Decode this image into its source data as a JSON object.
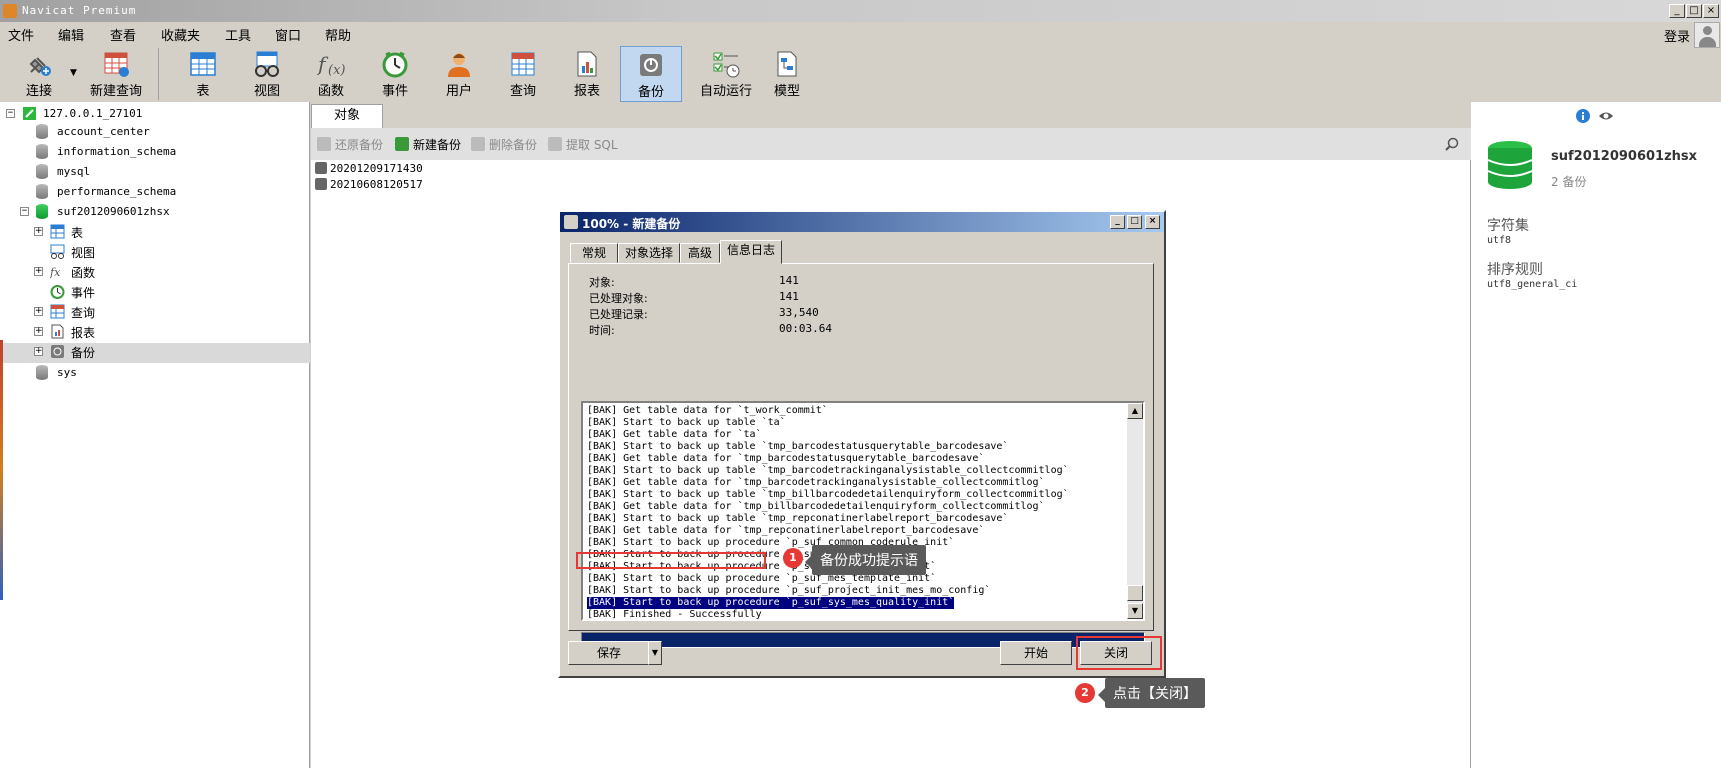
{
  "window": {
    "title": "Navicat Premium",
    "min": "_",
    "max": "□",
    "close": "×"
  },
  "menu": [
    "文件",
    "编辑",
    "查看",
    "收藏夹",
    "工具",
    "窗口",
    "帮助"
  ],
  "login_label": "登录",
  "toolbar": [
    {
      "label": "连接",
      "icon": "plug-icon"
    },
    {
      "label": "新建查询",
      "icon": "new-query-icon"
    },
    {
      "label": "表",
      "icon": "table-icon"
    },
    {
      "label": "视图",
      "icon": "view-icon"
    },
    {
      "label": "函数",
      "icon": "function-icon"
    },
    {
      "label": "事件",
      "icon": "clock-icon"
    },
    {
      "label": "用户",
      "icon": "user-icon"
    },
    {
      "label": "查询",
      "icon": "query-icon"
    },
    {
      "label": "报表",
      "icon": "report-icon"
    },
    {
      "label": "备份",
      "icon": "backup-icon",
      "active": true
    },
    {
      "label": "自动运行",
      "icon": "autorun-icon"
    },
    {
      "label": "模型",
      "icon": "model-icon"
    }
  ],
  "tree": {
    "connection": "127.0.0.1_27101",
    "databases": [
      "account_center",
      "information_schema",
      "mysql",
      "performance_schema",
      "suf2012090601zhsx"
    ],
    "children": [
      "表",
      "视图",
      "函数",
      "事件",
      "查询",
      "报表",
      "备份"
    ],
    "last_db": "sys"
  },
  "objects": {
    "tab": "对象",
    "actions": [
      "还原备份",
      "新建备份",
      "删除备份",
      "提取 SQL"
    ],
    "backups": [
      "20201209171430",
      "20210608120517"
    ]
  },
  "info": {
    "name": "suf2012090601zhsx",
    "sub": "2 备份",
    "charset_label": "字符集",
    "charset_value": "utf8",
    "collation_label": "排序规则",
    "collation_value": "utf8_general_ci"
  },
  "dialog": {
    "title": "100% - 新建备份",
    "tabs": [
      "常规",
      "对象选择",
      "高级",
      "信息日志"
    ],
    "stats": [
      {
        "label": "对象:",
        "value": "141"
      },
      {
        "label": "已处理对象:",
        "value": "141"
      },
      {
        "label": "已处理记录:",
        "value": "33,540"
      },
      {
        "label": "时间:",
        "value": "00:03.64"
      }
    ],
    "log": [
      "[BAK] Get table data for `t_work_commit`",
      "[BAK] Start to back up table `ta`",
      "[BAK] Get table data for `ta`",
      "[BAK] Start to back up table `tmp_barcodestatusquerytable_barcodesave`",
      "[BAK] Get table data for `tmp_barcodestatusquerytable_barcodesave`",
      "[BAK] Start to back up table `tmp_barcodetrackinganalysistable_collectcommitlog`",
      "[BAK] Get table data for `tmp_barcodetrackinganalysistable_collectcommitlog`",
      "[BAK] Start to back up table `tmp_billbarcodedetailenquiryform_collectcommitlog`",
      "[BAK] Get table data for `tmp_billbarcodedetailenquiryform_collectcommitlog`",
      "[BAK] Start to back up table `tmp_repconatinerlabelreport_barcodesave`",
      "[BAK] Get table data for `tmp_repconatinerlabelreport_barcodesave`",
      "[BAK] Start to back up procedure `p_suf_common_coderule_init`",
      "[BAK] Start to back up procedure `p_suf_data_init`",
      "[BAK] Start to back up procedure `p_suf_mes_coderule_init`",
      "[BAK] Start to back up procedure `p_suf_mes_template_init`",
      "[BAK] Start to back up procedure `p_suf_project_init_mes_mo_config`",
      "[BAK] Start to back up procedure `p_suf_sys_mes_quality_init`",
      "[BAK] Finished - Successfully"
    ],
    "progress": 1.0,
    "save_label": "保存",
    "start_label": "开始",
    "close_label": "关闭"
  },
  "annotations": [
    {
      "num": "1",
      "text": "备份成功提示语"
    },
    {
      "num": "2",
      "text": "点击【关闭】"
    }
  ]
}
